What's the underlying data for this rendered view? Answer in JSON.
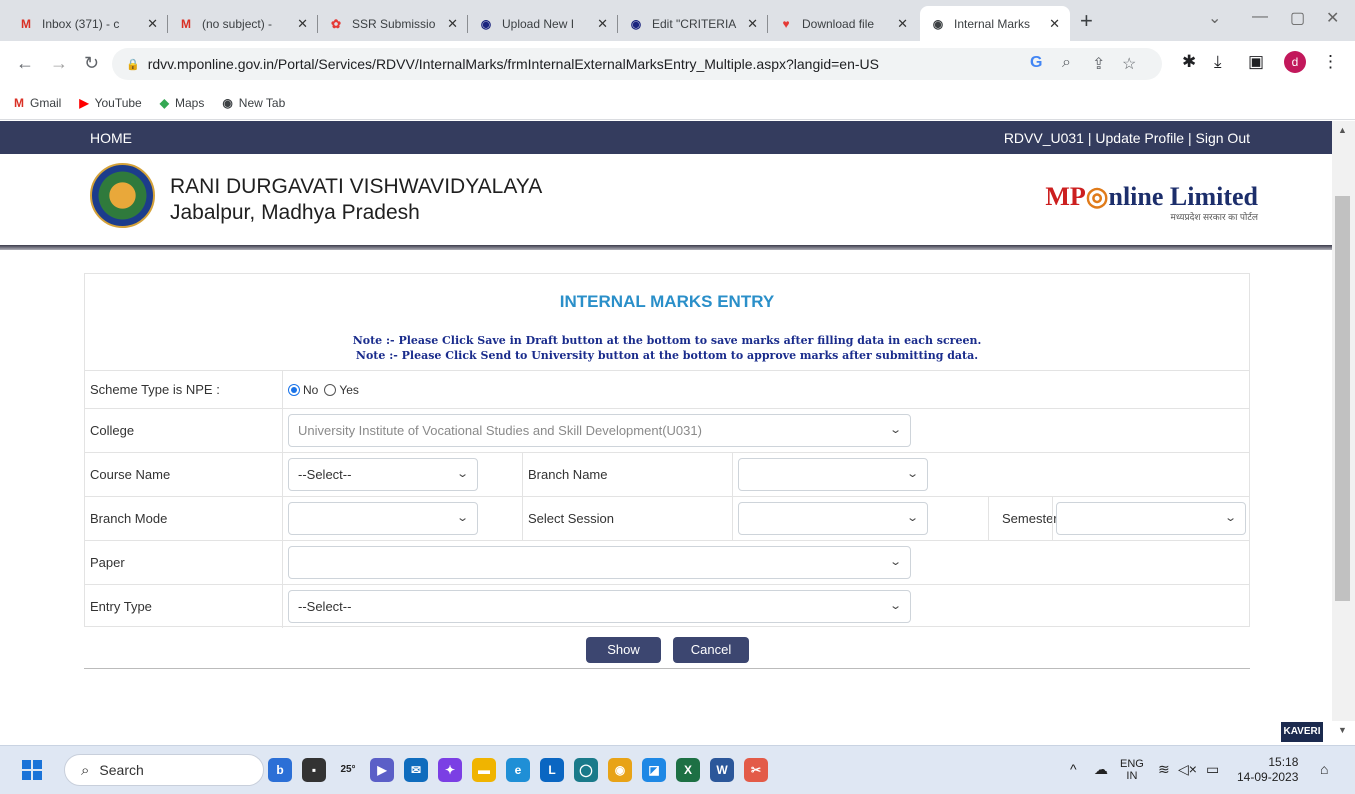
{
  "browser": {
    "tabs": [
      {
        "label": "Inbox (371) - c",
        "icon": "M",
        "icon_color": "#d93025"
      },
      {
        "label": "(no subject) -",
        "icon": "M",
        "icon_color": "#d93025"
      },
      {
        "label": "SSR Submissio",
        "icon": "✿",
        "icon_color": "#e53935"
      },
      {
        "label": "Upload New I",
        "icon": "◉",
        "icon_color": "#1a237e"
      },
      {
        "label": "Edit \"CRITERIA",
        "icon": "◉",
        "icon_color": "#1a237e"
      },
      {
        "label": "Download file",
        "icon": "♥",
        "icon_color": "#e53935"
      },
      {
        "label": "Internal Marks",
        "icon": "◉",
        "icon_color": "#3c4043"
      }
    ],
    "url": "rdvv.mponline.gov.in/Portal/Services/RDVV/InternalMarks/frmInternalExternalMarksEntry_Multiple.aspx?langid=en-US",
    "avatar_letter": "d",
    "bookmarks": [
      {
        "label": "Gmail",
        "icon": "M"
      },
      {
        "label": "YouTube",
        "icon": "▶"
      },
      {
        "label": "Maps",
        "icon": "◆"
      },
      {
        "label": "New Tab",
        "icon": "◉"
      }
    ]
  },
  "site": {
    "home": "HOME",
    "top_links": "RDVV_U031 | Update Profile | Sign Out",
    "uni_line1": "RANI DURGAVATI VISHWAVIDYALAYA",
    "uni_line2": "Jabalpur, Madhya Pradesh",
    "partner_mp": "MP",
    "partner_rest": "nline Limited",
    "partner_sub": "मध्यप्रदेश सरकार का पोर्टल",
    "kaveri": "KAVERI"
  },
  "form": {
    "title": "INTERNAL MARKS ENTRY",
    "note1": "Note :- Please Click Save in Draft button at the bottom to save marks after filling data in each screen.",
    "note2": "Note :- Please Click Send to University button at the bottom to approve marks after submitting data.",
    "npe_label": "Scheme Type is NPE :",
    "npe_no": "No",
    "npe_yes": "Yes",
    "npe_selected": "No",
    "college_label": "College",
    "college_value": "University Institute of Vocational Studies and Skill Development(U031)",
    "course_label": "Course Name",
    "course_value": "--Select--",
    "branch_name_label": "Branch Name",
    "branch_name_value": "",
    "branch_mode_label": "Branch Mode",
    "branch_mode_value": "",
    "session_label": "Select Session",
    "session_value": "",
    "semester_label": "Semester",
    "semester_value": "",
    "paper_label": "Paper",
    "paper_value": "",
    "entry_type_label": "Entry Type",
    "entry_type_value": "--Select--",
    "show_button": "Show",
    "cancel_button": "Cancel"
  },
  "taskbar": {
    "search_label": "Search",
    "weather": "25°",
    "lang_line1": "ENG",
    "lang_line2": "IN",
    "time": "15:18",
    "date": "14-09-2023"
  }
}
